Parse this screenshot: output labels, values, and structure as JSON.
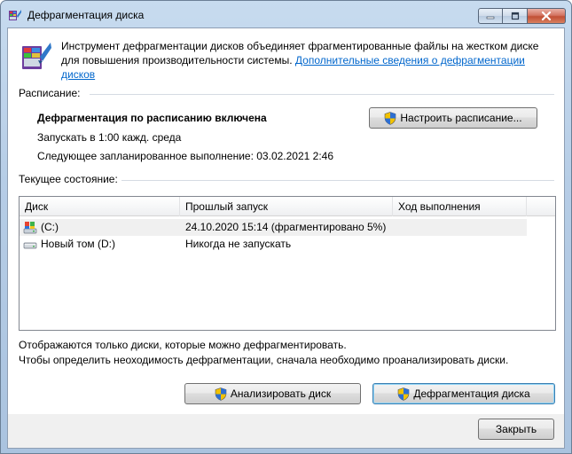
{
  "window": {
    "title": "Дефрагментация диска"
  },
  "intro": {
    "text": "Инструмент дефрагментации дисков объединяет фрагментированные файлы на жестком диске для повышения производительности системы.",
    "link": "Дополнительные сведения о дефрагментации дисков"
  },
  "schedule": {
    "section_label": "Расписание:",
    "status": "Дефрагментация по расписанию включена",
    "run_at": "Запускать в 1:00 кажд. среда",
    "next_run": "Следующее запланированное выполнение: 03.02.2021 2:46",
    "configure_button": "Настроить расписание..."
  },
  "current": {
    "section_label": "Текущее состояние:",
    "columns": [
      "Диск",
      "Прошлый запуск",
      "Ход выполнения"
    ],
    "rows": [
      {
        "disk": "(C:)",
        "last_run": "24.10.2020 15:14 (фрагментировано 5%)",
        "progress": "",
        "icon": "system-drive-icon"
      },
      {
        "disk": "Новый том (D:)",
        "last_run": "Никогда не запускать",
        "progress": "",
        "icon": "hard-drive-icon"
      }
    ]
  },
  "notes": {
    "line1": "Отображаются только диски, которые можно дефрагментировать.",
    "line2": "Чтобы определить неоходимость  дефрагментации, сначала необходимо проанализировать диски."
  },
  "actions": {
    "analyze_button": "Анализировать диск",
    "defrag_button": "Дефрагментация диска",
    "close_button": "Закрыть"
  },
  "colors": {
    "link": "#0066cc",
    "window_frame": "#b6cde6",
    "client_bg": "#f0f0f0"
  }
}
